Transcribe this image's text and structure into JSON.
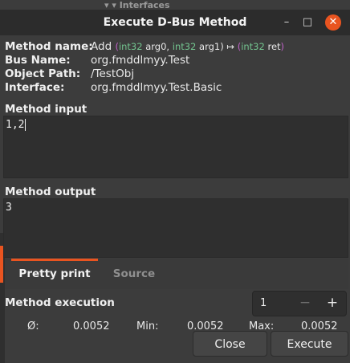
{
  "background": {
    "peek_text": "Interfaces"
  },
  "window": {
    "title": "Execute D-Bus Method",
    "minimize": "–",
    "maximize": "□",
    "close": "✕"
  },
  "info": {
    "method_name_label": "Method name:",
    "method_name": "Add",
    "signature": {
      "open": "(",
      "arg0_type": "int32",
      "arg0_name": "arg0,",
      "arg1_type": "int32",
      "arg1_name": "arg1)",
      "arrow": "↦",
      "ret_open": "(",
      "ret_type": "int32",
      "ret_name": "ret",
      "ret_close": ")"
    },
    "bus_name_label": "Bus Name:",
    "bus_name": "org.fmddlmyy.Test",
    "object_path_label": "Object Path:",
    "object_path": "/TestObj",
    "interface_label": "Interface:",
    "interface": "org.fmddlmyy.Test.Basic"
  },
  "method_input": {
    "label": "Method input",
    "value": "1,2"
  },
  "method_output": {
    "label": "Method output",
    "value": "3"
  },
  "tabs": [
    {
      "label": "Pretty print",
      "active": true
    },
    {
      "label": "Source",
      "active": false
    }
  ],
  "execution": {
    "label": "Method execution",
    "count": "1",
    "minus": "−",
    "plus": "+",
    "avg_label": "Ø:",
    "avg_value": "0.0052",
    "min_label": "Min:",
    "min_value": "0.0052",
    "max_label": "Max:",
    "max_value": "0.0052"
  },
  "buttons": {
    "close": "Close",
    "execute": "Execute"
  },
  "colors": {
    "accent": "#e95420",
    "type": "#73c48f",
    "paren": "#c063c9"
  }
}
